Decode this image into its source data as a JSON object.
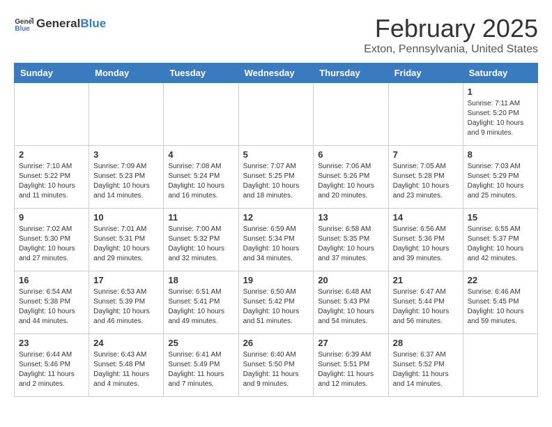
{
  "header": {
    "logo_general": "General",
    "logo_blue": "Blue",
    "month": "February 2025",
    "location": "Exton, Pennsylvania, United States"
  },
  "days_of_week": [
    "Sunday",
    "Monday",
    "Tuesday",
    "Wednesday",
    "Thursday",
    "Friday",
    "Saturday"
  ],
  "weeks": [
    [
      {
        "day": "",
        "text": ""
      },
      {
        "day": "",
        "text": ""
      },
      {
        "day": "",
        "text": ""
      },
      {
        "day": "",
        "text": ""
      },
      {
        "day": "",
        "text": ""
      },
      {
        "day": "",
        "text": ""
      },
      {
        "day": "1",
        "text": "Sunrise: 7:11 AM\nSunset: 5:20 PM\nDaylight: 10 hours and 9 minutes."
      }
    ],
    [
      {
        "day": "2",
        "text": "Sunrise: 7:10 AM\nSunset: 5:22 PM\nDaylight: 10 hours and 11 minutes."
      },
      {
        "day": "3",
        "text": "Sunrise: 7:09 AM\nSunset: 5:23 PM\nDaylight: 10 hours and 14 minutes."
      },
      {
        "day": "4",
        "text": "Sunrise: 7:08 AM\nSunset: 5:24 PM\nDaylight: 10 hours and 16 minutes."
      },
      {
        "day": "5",
        "text": "Sunrise: 7:07 AM\nSunset: 5:25 PM\nDaylight: 10 hours and 18 minutes."
      },
      {
        "day": "6",
        "text": "Sunrise: 7:06 AM\nSunset: 5:26 PM\nDaylight: 10 hours and 20 minutes."
      },
      {
        "day": "7",
        "text": "Sunrise: 7:05 AM\nSunset: 5:28 PM\nDaylight: 10 hours and 23 minutes."
      },
      {
        "day": "8",
        "text": "Sunrise: 7:03 AM\nSunset: 5:29 PM\nDaylight: 10 hours and 25 minutes."
      }
    ],
    [
      {
        "day": "9",
        "text": "Sunrise: 7:02 AM\nSunset: 5:30 PM\nDaylight: 10 hours and 27 minutes."
      },
      {
        "day": "10",
        "text": "Sunrise: 7:01 AM\nSunset: 5:31 PM\nDaylight: 10 hours and 29 minutes."
      },
      {
        "day": "11",
        "text": "Sunrise: 7:00 AM\nSunset: 5:32 PM\nDaylight: 10 hours and 32 minutes."
      },
      {
        "day": "12",
        "text": "Sunrise: 6:59 AM\nSunset: 5:34 PM\nDaylight: 10 hours and 34 minutes."
      },
      {
        "day": "13",
        "text": "Sunrise: 6:58 AM\nSunset: 5:35 PM\nDaylight: 10 hours and 37 minutes."
      },
      {
        "day": "14",
        "text": "Sunrise: 6:56 AM\nSunset: 5:36 PM\nDaylight: 10 hours and 39 minutes."
      },
      {
        "day": "15",
        "text": "Sunrise: 6:55 AM\nSunset: 5:37 PM\nDaylight: 10 hours and 42 minutes."
      }
    ],
    [
      {
        "day": "16",
        "text": "Sunrise: 6:54 AM\nSunset: 5:38 PM\nDaylight: 10 hours and 44 minutes."
      },
      {
        "day": "17",
        "text": "Sunrise: 6:53 AM\nSunset: 5:39 PM\nDaylight: 10 hours and 46 minutes."
      },
      {
        "day": "18",
        "text": "Sunrise: 6:51 AM\nSunset: 5:41 PM\nDaylight: 10 hours and 49 minutes."
      },
      {
        "day": "19",
        "text": "Sunrise: 6:50 AM\nSunset: 5:42 PM\nDaylight: 10 hours and 51 minutes."
      },
      {
        "day": "20",
        "text": "Sunrise: 6:48 AM\nSunset: 5:43 PM\nDaylight: 10 hours and 54 minutes."
      },
      {
        "day": "21",
        "text": "Sunrise: 6:47 AM\nSunset: 5:44 PM\nDaylight: 10 hours and 56 minutes."
      },
      {
        "day": "22",
        "text": "Sunrise: 6:46 AM\nSunset: 5:45 PM\nDaylight: 10 hours and 59 minutes."
      }
    ],
    [
      {
        "day": "23",
        "text": "Sunrise: 6:44 AM\nSunset: 5:46 PM\nDaylight: 11 hours and 2 minutes."
      },
      {
        "day": "24",
        "text": "Sunrise: 6:43 AM\nSunset: 5:48 PM\nDaylight: 11 hours and 4 minutes."
      },
      {
        "day": "25",
        "text": "Sunrise: 6:41 AM\nSunset: 5:49 PM\nDaylight: 11 hours and 7 minutes."
      },
      {
        "day": "26",
        "text": "Sunrise: 6:40 AM\nSunset: 5:50 PM\nDaylight: 11 hours and 9 minutes."
      },
      {
        "day": "27",
        "text": "Sunrise: 6:39 AM\nSunset: 5:51 PM\nDaylight: 11 hours and 12 minutes."
      },
      {
        "day": "28",
        "text": "Sunrise: 6:37 AM\nSunset: 5:52 PM\nDaylight: 11 hours and 14 minutes."
      },
      {
        "day": "",
        "text": ""
      }
    ]
  ]
}
